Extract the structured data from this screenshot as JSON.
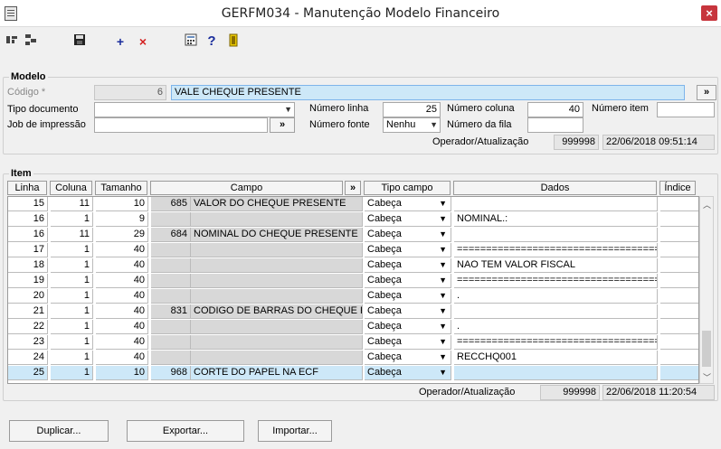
{
  "window": {
    "title": "GERFM034 - Manutenção Modelo Financeiro"
  },
  "toolbar": {
    "add": "+",
    "delete": "×",
    "help": "?"
  },
  "modelo": {
    "group_label": "Modelo",
    "codigo_label": "Código *",
    "codigo_value": "6",
    "descricao_value": "VALE CHEQUE PRESENTE",
    "expand_label": "»",
    "tipo_documento_label": "Tipo documento",
    "tipo_documento_value": "",
    "job_impressao_label": "Job de impressão",
    "job_impressao_value": "",
    "numero_linha_label": "Número linha",
    "numero_linha_value": "25",
    "numero_coluna_label": "Número coluna",
    "numero_coluna_value": "40",
    "numero_item_label": "Número item",
    "numero_item_value": "",
    "numero_fonte_label": "Número fonte",
    "numero_fonte_value": "Nenhu",
    "numero_fila_label": "Número da fila",
    "numero_fila_value": "",
    "operador_label": "Operador/Atualização",
    "operador_value": "999998",
    "atualizacao_value": "22/06/2018 09:51:14"
  },
  "item": {
    "group_label": "Item",
    "columns": {
      "linha": "Linha",
      "coluna": "Coluna",
      "tamanho": "Tamanho",
      "campo": "Campo",
      "expand": "»",
      "tipo_campo": "Tipo campo",
      "dados": "Dados",
      "indice": "Índice"
    },
    "rows": [
      {
        "linha": "15",
        "coluna": "11",
        "tamanho": "10",
        "campo_cod": "685",
        "campo": "VALOR DO CHEQUE PRESENTE",
        "tipo": "Cabeça",
        "dados": ""
      },
      {
        "linha": "16",
        "coluna": "1",
        "tamanho": "9",
        "campo_cod": "",
        "campo": "",
        "tipo": "Cabeça",
        "dados": "NOMINAL.:"
      },
      {
        "linha": "16",
        "coluna": "11",
        "tamanho": "29",
        "campo_cod": "684",
        "campo": "NOMINAL DO CHEQUE PRESENTE",
        "tipo": "Cabeça",
        "dados": ""
      },
      {
        "linha": "17",
        "coluna": "1",
        "tamanho": "40",
        "campo_cod": "",
        "campo": "",
        "tipo": "Cabeça",
        "dados": "======================================="
      },
      {
        "linha": "18",
        "coluna": "1",
        "tamanho": "40",
        "campo_cod": "",
        "campo": "",
        "tipo": "Cabeça",
        "dados": "      NAO TEM VALOR FISCAL"
      },
      {
        "linha": "19",
        "coluna": "1",
        "tamanho": "40",
        "campo_cod": "",
        "campo": "",
        "tipo": "Cabeça",
        "dados": "======================================="
      },
      {
        "linha": "20",
        "coluna": "1",
        "tamanho": "40",
        "campo_cod": "",
        "campo": "",
        "tipo": "Cabeça",
        "dados": "."
      },
      {
        "linha": "21",
        "coluna": "1",
        "tamanho": "40",
        "campo_cod": "831",
        "campo": "CODIGO DE BARRAS DO CHEQUE F",
        "tipo": "Cabeça",
        "dados": ""
      },
      {
        "linha": "22",
        "coluna": "1",
        "tamanho": "40",
        "campo_cod": "",
        "campo": "",
        "tipo": "Cabeça",
        "dados": "."
      },
      {
        "linha": "23",
        "coluna": "1",
        "tamanho": "40",
        "campo_cod": "",
        "campo": "",
        "tipo": "Cabeça",
        "dados": "======================================="
      },
      {
        "linha": "24",
        "coluna": "1",
        "tamanho": "40",
        "campo_cod": "",
        "campo": "",
        "tipo": "Cabeça",
        "dados": "RECCHQ001"
      },
      {
        "linha": "25",
        "coluna": "1",
        "tamanho": "10",
        "campo_cod": "968",
        "campo": "CORTE DO PAPEL NA ECF",
        "tipo": "Cabeça",
        "dados": ""
      }
    ],
    "operador_label": "Operador/Atualização",
    "operador_value": "999998",
    "atualizacao_value": "22/06/2018 11:20:54"
  },
  "buttons": {
    "duplicar": "Duplicar...",
    "exportar": "Exportar...",
    "importar": "Importar..."
  }
}
